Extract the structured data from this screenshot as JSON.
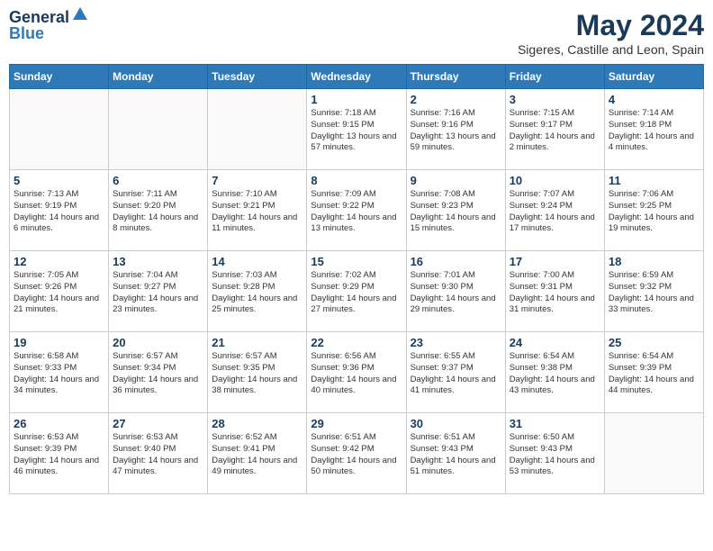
{
  "header": {
    "logo_line1": "General",
    "logo_line2": "Blue",
    "month_title": "May 2024",
    "location": "Sigeres, Castille and Leon, Spain"
  },
  "days_of_week": [
    "Sunday",
    "Monday",
    "Tuesday",
    "Wednesday",
    "Thursday",
    "Friday",
    "Saturday"
  ],
  "weeks": [
    [
      {
        "num": "",
        "text": ""
      },
      {
        "num": "",
        "text": ""
      },
      {
        "num": "",
        "text": ""
      },
      {
        "num": "1",
        "text": "Sunrise: 7:18 AM\nSunset: 9:15 PM\nDaylight: 13 hours and 57 minutes."
      },
      {
        "num": "2",
        "text": "Sunrise: 7:16 AM\nSunset: 9:16 PM\nDaylight: 13 hours and 59 minutes."
      },
      {
        "num": "3",
        "text": "Sunrise: 7:15 AM\nSunset: 9:17 PM\nDaylight: 14 hours and 2 minutes."
      },
      {
        "num": "4",
        "text": "Sunrise: 7:14 AM\nSunset: 9:18 PM\nDaylight: 14 hours and 4 minutes."
      }
    ],
    [
      {
        "num": "5",
        "text": "Sunrise: 7:13 AM\nSunset: 9:19 PM\nDaylight: 14 hours and 6 minutes."
      },
      {
        "num": "6",
        "text": "Sunrise: 7:11 AM\nSunset: 9:20 PM\nDaylight: 14 hours and 8 minutes."
      },
      {
        "num": "7",
        "text": "Sunrise: 7:10 AM\nSunset: 9:21 PM\nDaylight: 14 hours and 11 minutes."
      },
      {
        "num": "8",
        "text": "Sunrise: 7:09 AM\nSunset: 9:22 PM\nDaylight: 14 hours and 13 minutes."
      },
      {
        "num": "9",
        "text": "Sunrise: 7:08 AM\nSunset: 9:23 PM\nDaylight: 14 hours and 15 minutes."
      },
      {
        "num": "10",
        "text": "Sunrise: 7:07 AM\nSunset: 9:24 PM\nDaylight: 14 hours and 17 minutes."
      },
      {
        "num": "11",
        "text": "Sunrise: 7:06 AM\nSunset: 9:25 PM\nDaylight: 14 hours and 19 minutes."
      }
    ],
    [
      {
        "num": "12",
        "text": "Sunrise: 7:05 AM\nSunset: 9:26 PM\nDaylight: 14 hours and 21 minutes."
      },
      {
        "num": "13",
        "text": "Sunrise: 7:04 AM\nSunset: 9:27 PM\nDaylight: 14 hours and 23 minutes."
      },
      {
        "num": "14",
        "text": "Sunrise: 7:03 AM\nSunset: 9:28 PM\nDaylight: 14 hours and 25 minutes."
      },
      {
        "num": "15",
        "text": "Sunrise: 7:02 AM\nSunset: 9:29 PM\nDaylight: 14 hours and 27 minutes."
      },
      {
        "num": "16",
        "text": "Sunrise: 7:01 AM\nSunset: 9:30 PM\nDaylight: 14 hours and 29 minutes."
      },
      {
        "num": "17",
        "text": "Sunrise: 7:00 AM\nSunset: 9:31 PM\nDaylight: 14 hours and 31 minutes."
      },
      {
        "num": "18",
        "text": "Sunrise: 6:59 AM\nSunset: 9:32 PM\nDaylight: 14 hours and 33 minutes."
      }
    ],
    [
      {
        "num": "19",
        "text": "Sunrise: 6:58 AM\nSunset: 9:33 PM\nDaylight: 14 hours and 34 minutes."
      },
      {
        "num": "20",
        "text": "Sunrise: 6:57 AM\nSunset: 9:34 PM\nDaylight: 14 hours and 36 minutes."
      },
      {
        "num": "21",
        "text": "Sunrise: 6:57 AM\nSunset: 9:35 PM\nDaylight: 14 hours and 38 minutes."
      },
      {
        "num": "22",
        "text": "Sunrise: 6:56 AM\nSunset: 9:36 PM\nDaylight: 14 hours and 40 minutes."
      },
      {
        "num": "23",
        "text": "Sunrise: 6:55 AM\nSunset: 9:37 PM\nDaylight: 14 hours and 41 minutes."
      },
      {
        "num": "24",
        "text": "Sunrise: 6:54 AM\nSunset: 9:38 PM\nDaylight: 14 hours and 43 minutes."
      },
      {
        "num": "25",
        "text": "Sunrise: 6:54 AM\nSunset: 9:39 PM\nDaylight: 14 hours and 44 minutes."
      }
    ],
    [
      {
        "num": "26",
        "text": "Sunrise: 6:53 AM\nSunset: 9:39 PM\nDaylight: 14 hours and 46 minutes."
      },
      {
        "num": "27",
        "text": "Sunrise: 6:53 AM\nSunset: 9:40 PM\nDaylight: 14 hours and 47 minutes."
      },
      {
        "num": "28",
        "text": "Sunrise: 6:52 AM\nSunset: 9:41 PM\nDaylight: 14 hours and 49 minutes."
      },
      {
        "num": "29",
        "text": "Sunrise: 6:51 AM\nSunset: 9:42 PM\nDaylight: 14 hours and 50 minutes."
      },
      {
        "num": "30",
        "text": "Sunrise: 6:51 AM\nSunset: 9:43 PM\nDaylight: 14 hours and 51 minutes."
      },
      {
        "num": "31",
        "text": "Sunrise: 6:50 AM\nSunset: 9:43 PM\nDaylight: 14 hours and 53 minutes."
      },
      {
        "num": "",
        "text": ""
      }
    ]
  ]
}
